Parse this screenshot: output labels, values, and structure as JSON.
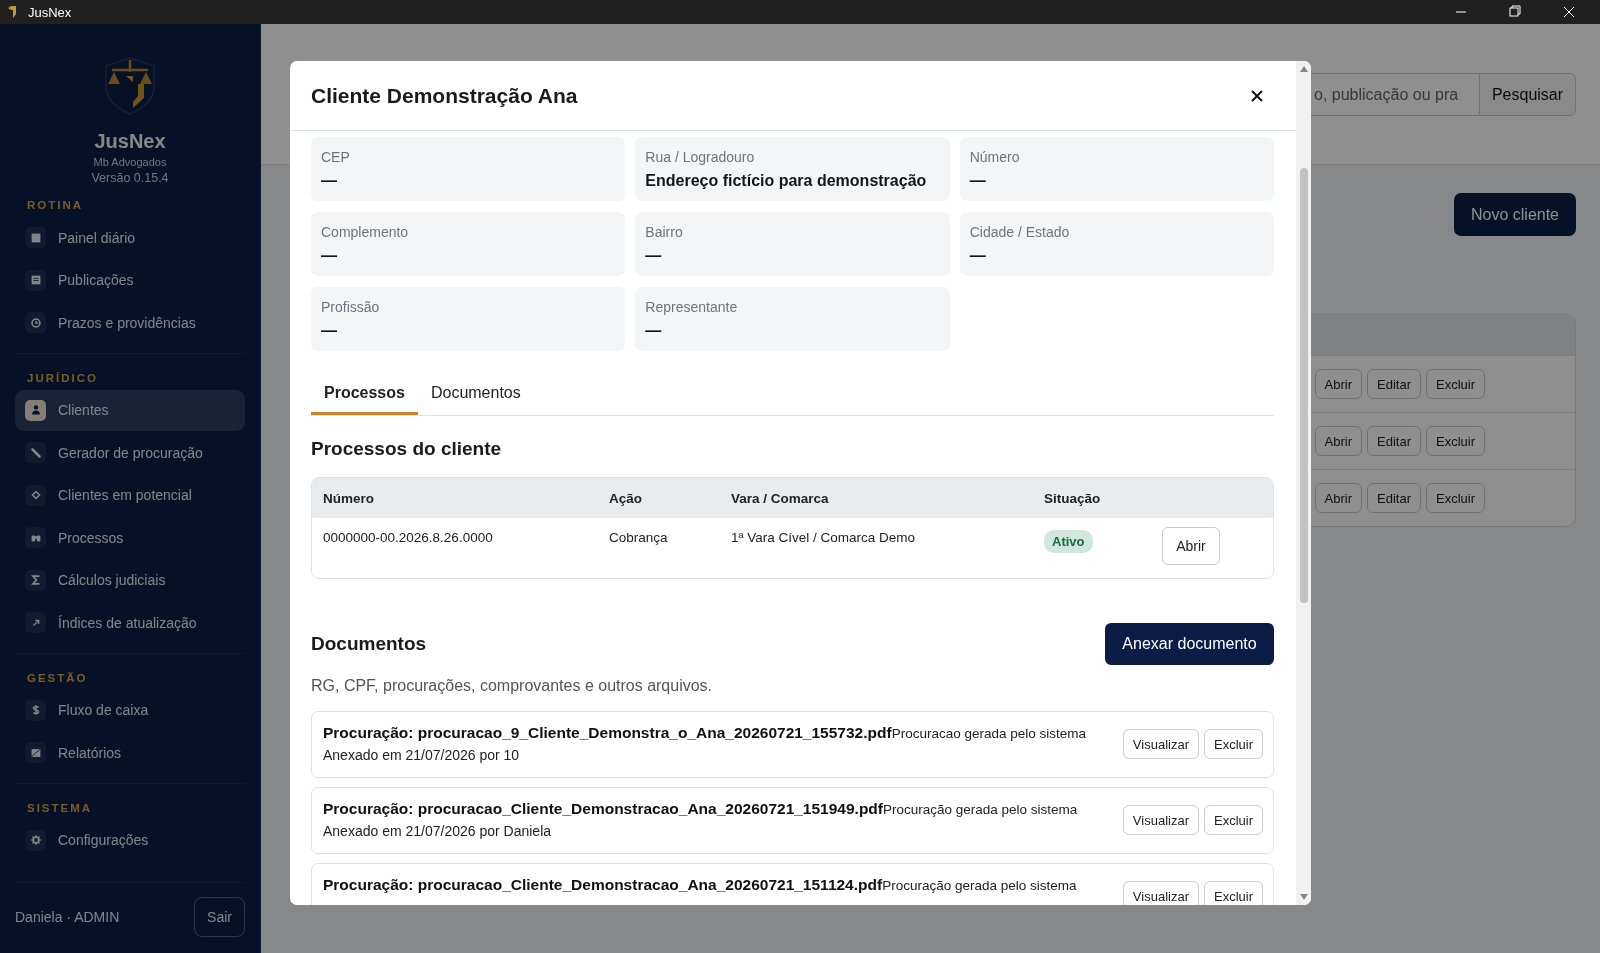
{
  "window": {
    "title": "JusNex"
  },
  "sidebar": {
    "brand": "JusNex",
    "office": "Mb Advogados",
    "version": "Versão 0.15.4",
    "sections": [
      {
        "heading": "ROTINA",
        "items": [
          {
            "label": "Painel diário",
            "kind": "grid",
            "selected": false
          },
          {
            "label": "Publicações",
            "kind": "list",
            "selected": false
          },
          {
            "label": "Prazos e providências",
            "kind": "clock",
            "selected": false
          }
        ]
      },
      {
        "heading": "JURÍDICO",
        "items": [
          {
            "label": "Clientes",
            "kind": "person",
            "selected": true
          },
          {
            "label": "Gerador de procuração",
            "kind": "pen",
            "selected": false
          },
          {
            "label": "Clientes em potencial",
            "kind": "diamond",
            "selected": false
          },
          {
            "label": "Processos",
            "kind": "binoculars",
            "selected": false
          },
          {
            "label": "Cálculos judiciais",
            "kind": "sigma",
            "selected": false
          },
          {
            "label": "Índices de atualização",
            "kind": "arrow",
            "selected": false
          }
        ]
      },
      {
        "heading": "GESTÃO",
        "items": [
          {
            "label": "Fluxo de caixa",
            "kind": "dollar",
            "selected": false
          },
          {
            "label": "Relatórios",
            "kind": "report",
            "selected": false
          }
        ]
      },
      {
        "heading": "SISTEMA",
        "items": [
          {
            "label": "Configurações",
            "kind": "gear",
            "selected": false
          }
        ]
      }
    ],
    "user": "Daniela · ADMIN",
    "logout": "Sair"
  },
  "page": {
    "search_placeholder": "o, publicação ou pra",
    "search_button": "Pesquisar",
    "new_button": "Novo cliente",
    "rows": [
      {
        "actions": [
          "Abrir",
          "Editar",
          "Excluir"
        ]
      },
      {
        "actions": [
          "Abrir",
          "Editar",
          "Excluir"
        ]
      },
      {
        "actions": [
          "Abrir",
          "Editar",
          "Excluir"
        ]
      }
    ]
  },
  "modal": {
    "title": "Cliente Demonstração Ana",
    "fields": [
      {
        "label": "CEP",
        "value": "—"
      },
      {
        "label": "Rua / Logradouro",
        "value": "Endereço fictício para demonstração"
      },
      {
        "label": "Número",
        "value": "—"
      },
      {
        "label": "Complemento",
        "value": "—"
      },
      {
        "label": "Bairro",
        "value": "—"
      },
      {
        "label": "Cidade / Estado",
        "value": "—"
      },
      {
        "label": "Profissão",
        "value": "—"
      },
      {
        "label": "Representante",
        "value": "—"
      }
    ],
    "tabs": [
      {
        "label": "Processos",
        "selected": true
      },
      {
        "label": "Documentos",
        "selected": false
      }
    ],
    "processes": {
      "heading": "Processos do cliente",
      "columns": [
        "Número",
        "Ação",
        "Vara / Comarca",
        "Situação"
      ],
      "rows": [
        {
          "number": "0000000-00.2026.8.26.0000",
          "action": "Cobrança",
          "court": "1ª Vara Cível / Comarca Demo",
          "status": "Ativo",
          "button": "Abrir"
        }
      ]
    },
    "documents": {
      "heading": "Documentos",
      "attach_button": "Anexar documento",
      "subtitle": "RG, CPF, procurações, comprovantes e outros arquivos.",
      "items": [
        {
          "title": "Procuração: procuracao_9_Cliente_Demonstra_o_Ana_20260721_155732.pdf",
          "description": "Procuracao gerada pelo sistema",
          "meta": "Anexado em 21/07/2026 por 10",
          "view": "Visualizar",
          "delete": "Excluir"
        },
        {
          "title": "Procuração: procuracao_Cliente_Demonstracao_Ana_20260721_151949.pdf",
          "description": "Procuração gerada pelo sistema",
          "meta": "Anexado em 21/07/2026 por Daniela",
          "view": "Visualizar",
          "delete": "Excluir"
        },
        {
          "title": "Procuração: procuracao_Cliente_Demonstracao_Ana_20260721_151124.pdf",
          "description": "Procuração gerada pelo sistema",
          "view": "Visualizar",
          "delete": "Excluir"
        }
      ]
    }
  }
}
